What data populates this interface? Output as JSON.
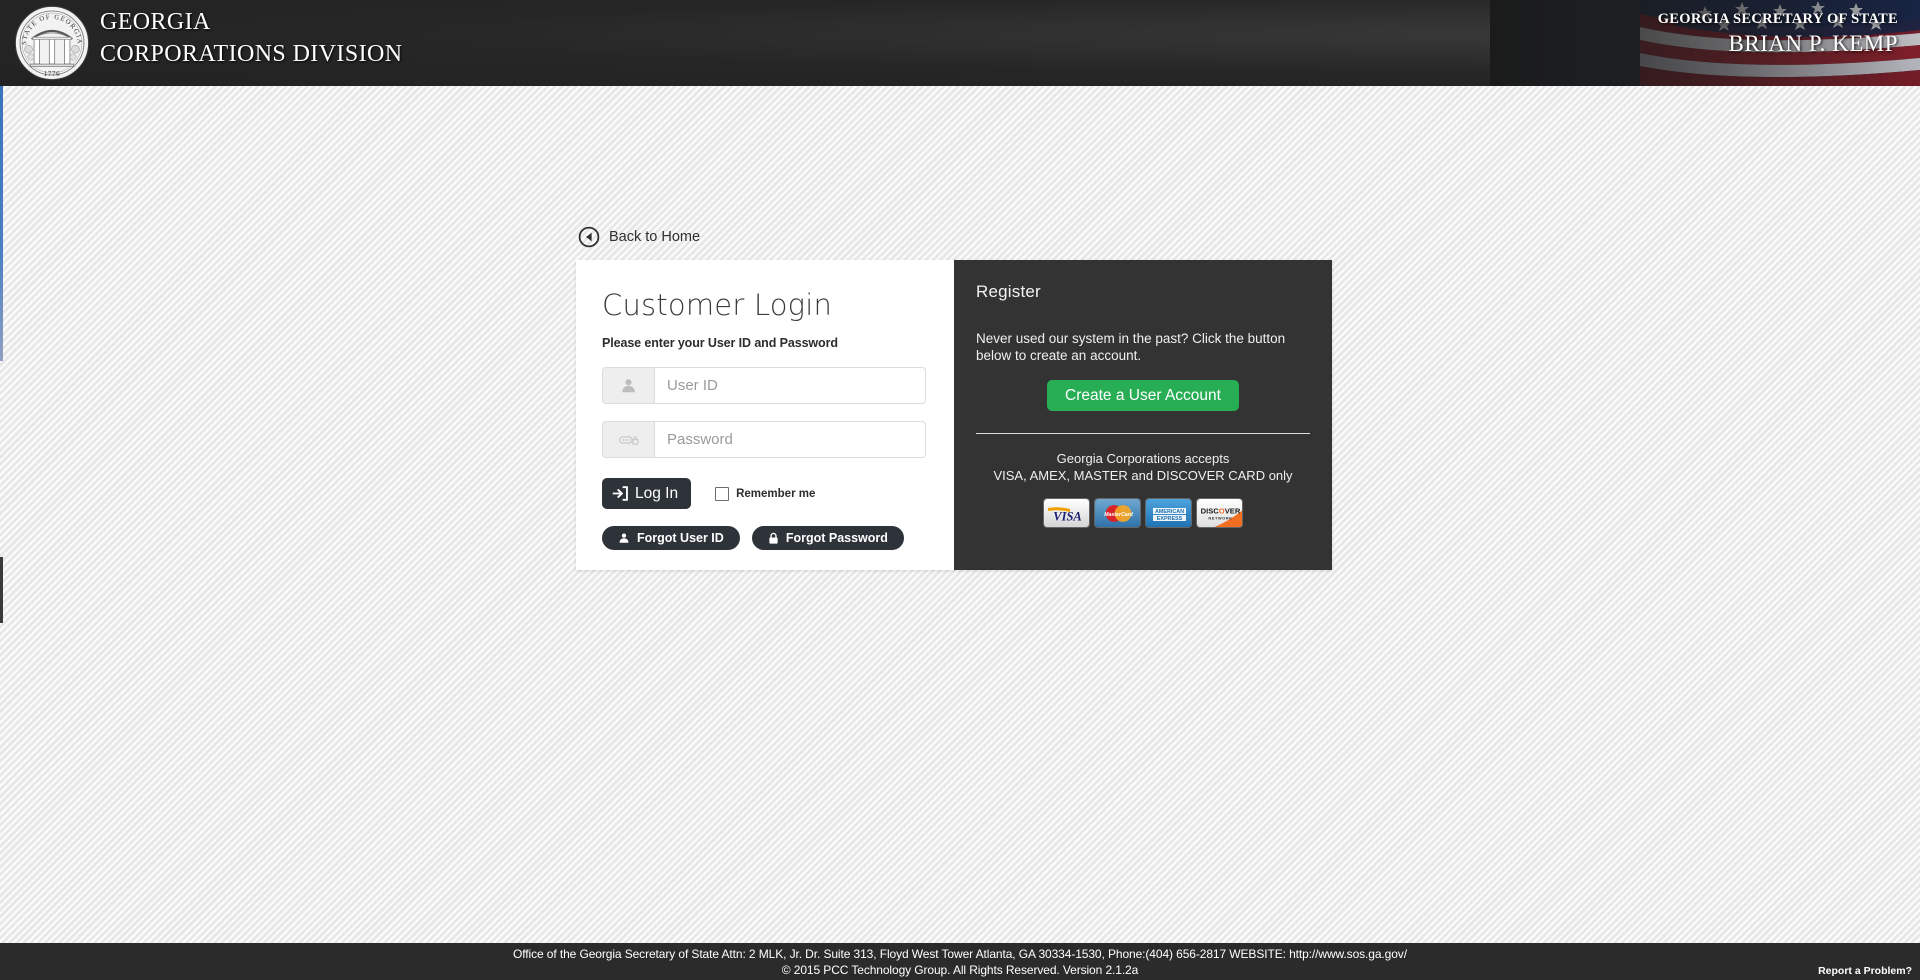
{
  "header": {
    "seal_icon": "georgia-state-seal",
    "seal_motto": "STATE OF GEORGIA",
    "seal_year": "1776",
    "title_line1": "GEORGIA",
    "title_line2": "CORPORATIONS DIVISION",
    "sos_label": "GEORGIA SECRETARY OF STATE",
    "sos_name": "BRIAN P. KEMP",
    "flag_icon": "american-flag"
  },
  "nav": {
    "back_icon": "arrow-circle-left-icon",
    "back_label": "Back to Home"
  },
  "login": {
    "title": "Customer Login",
    "subtitle": "Please enter your User ID and Password",
    "user_icon": "user-icon",
    "user_value": "",
    "user_placeholder": "User ID",
    "password_icon": "key-lock-icon",
    "password_value": "",
    "password_placeholder": "Password",
    "login_icon": "sign-in-icon",
    "login_label": "Log In",
    "remember_label": "Remember me",
    "remember_checked": false,
    "forgot_user_icon": "user-icon",
    "forgot_user_label": "Forgot User ID",
    "forgot_password_icon": "lock-icon",
    "forgot_password_label": "Forgot Password"
  },
  "register": {
    "title": "Register",
    "description": "Never used our system in the past? Click the button below to create an account.",
    "create_label": "Create a User Account",
    "create_color": "#27ae55",
    "accepts_line1": "Georgia Corporations accepts",
    "accepts_line2": "VISA, AMEX, MASTER and DISCOVER CARD only",
    "cards": [
      {
        "name": "visa-card-logo",
        "label": "VISA"
      },
      {
        "name": "mastercard-card-logo",
        "label": "MasterCard"
      },
      {
        "name": "amex-card-logo",
        "label": "AMERICAN EXPRESS"
      },
      {
        "name": "discover-card-logo",
        "label": "DISCOVER NETWORK"
      }
    ]
  },
  "footer": {
    "line1": "Office of the Georgia Secretary of State Attn: 2 MLK, Jr. Dr. Suite 313, Floyd West Tower Atlanta, GA 30334-1530, Phone:(404) 656-2817 WEBSITE: http://www.sos.ga.gov/",
    "line2": "© 2015 PCC Technology Group. All Rights Reserved. Version 2.1.2a",
    "report_label": "Report a Problem?"
  },
  "theme": {
    "header_bg": "#2b2b2b",
    "panel_dark": "#333333",
    "button_dark": "#2d3338",
    "accent_green": "#27ae55",
    "accent_blue": "#3b73bd"
  }
}
